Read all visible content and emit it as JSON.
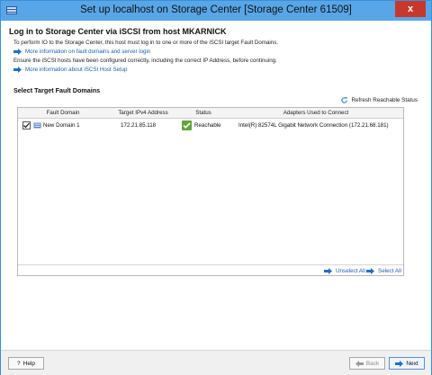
{
  "window": {
    "title": "Set up localhost on Storage Center [Storage Center 61509]",
    "close_label": "x"
  },
  "main": {
    "heading": "Log in to Storage Center via iSCSI from host MKARNICK",
    "description1": "To perform IO to the Storage Center, this host must log in to one or more of the iSCSI target Fault Domains.",
    "link1": "More information on fault domains and server login",
    "description2": "Ensure the iSCSI hosts have been configured correctly, including the correct IP Address, before continuing.",
    "link2": "More information about iSCSI Host Setup",
    "section_title": "Select Target Fault Domains",
    "refresh_label": "Refresh Reachable Status"
  },
  "table": {
    "columns": [
      "Fault Domain",
      "Target IPv4 Address",
      "Status",
      "Adapters Used to Connect"
    ],
    "rows": [
      {
        "checked": true,
        "fault_domain": "New Domain 1",
        "target_ip": "172.21.85.118",
        "status": "Reachable",
        "adapters": "Intel(R) 82574L Gigabit Network Connection (172.21.68.181)"
      }
    ],
    "unselect_all": "Unselect All",
    "select_all": "Select All"
  },
  "footer": {
    "help": "Help",
    "help_glyph": "?",
    "back": "Back",
    "next": "Next"
  },
  "colors": {
    "titlebar": "#58a6e8",
    "close": "#c7382c",
    "link": "#1a5fb4",
    "reachable": "#62a53a"
  }
}
